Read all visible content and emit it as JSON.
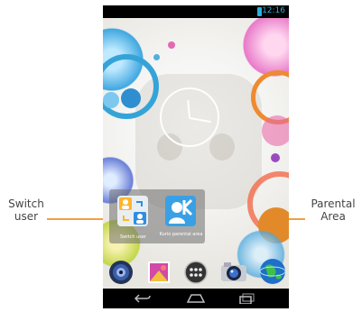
{
  "annotations": {
    "left_label": "Switch user",
    "right_label": "Parental Area",
    "arrow_color": "#f0a040"
  },
  "status_bar": {
    "time": "12:16",
    "battery_icon": "battery-icon"
  },
  "home_screen": {
    "clock": "analog-clock",
    "folder": {
      "apps": [
        {
          "label": "Switch user",
          "icon": "switch-user-icon"
        },
        {
          "label": "Kurio parental area",
          "icon": "kurio-parental-icon"
        }
      ]
    },
    "dock": [
      {
        "icon": "speaker-icon"
      },
      {
        "icon": "gallery-icon"
      },
      {
        "icon": "app-drawer-icon"
      },
      {
        "icon": "camera-icon"
      },
      {
        "icon": "browser-globe-icon"
      }
    ]
  },
  "navigation_bar": {
    "buttons": [
      {
        "icon": "back-icon"
      },
      {
        "icon": "home-icon"
      },
      {
        "icon": "recent-apps-icon"
      }
    ]
  },
  "colors": {
    "accent": "#2ab0e0",
    "folder_background": "#6e6e6e"
  }
}
